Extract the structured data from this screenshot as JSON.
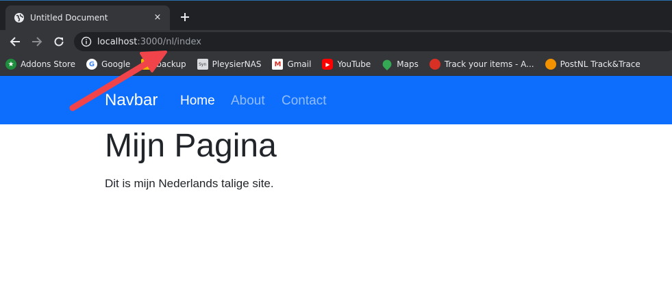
{
  "browser": {
    "tab": {
      "title": "Untitled Document",
      "favicon": "globe-icon",
      "close": "×"
    },
    "url": {
      "host": "localhost",
      "rest": ":3000/nl/index"
    },
    "bookmarks": [
      {
        "label": "Addons Store",
        "icon": "addons-store-icon",
        "color": "#1e8e3e",
        "glyph": "★"
      },
      {
        "label": "Google",
        "icon": "google-icon",
        "color": "#ffffff",
        "glyph": "G"
      },
      {
        "label": "backup",
        "icon": "folder-icon",
        "color": "#f2b400",
        "glyph": ""
      },
      {
        "label": "PleysierNAS",
        "icon": "synology-icon",
        "color": "#dadce0",
        "glyph": "Syn"
      },
      {
        "label": "Gmail",
        "icon": "gmail-icon",
        "color": "#ffffff",
        "glyph": "M"
      },
      {
        "label": "YouTube",
        "icon": "youtube-icon",
        "color": "#ff0000",
        "glyph": "▶"
      },
      {
        "label": "Maps",
        "icon": "maps-pin-icon",
        "color": "#34a853",
        "glyph": ""
      },
      {
        "label": "Track your items - A...",
        "icon": "tracking-icon",
        "color": "#d93025",
        "glyph": ""
      },
      {
        "label": "PostNL Track&Trace",
        "icon": "postnl-icon",
        "color": "#f39200",
        "glyph": ""
      }
    ]
  },
  "page": {
    "navbar": {
      "brand": "Navbar",
      "links": [
        "Home",
        "About",
        "Contact"
      ],
      "background": "#0d6efd"
    },
    "title": "Mijn Pagina",
    "lead": "Dit is mijn Nederlands talige site."
  },
  "annotation": {
    "color": "#f0444a"
  }
}
